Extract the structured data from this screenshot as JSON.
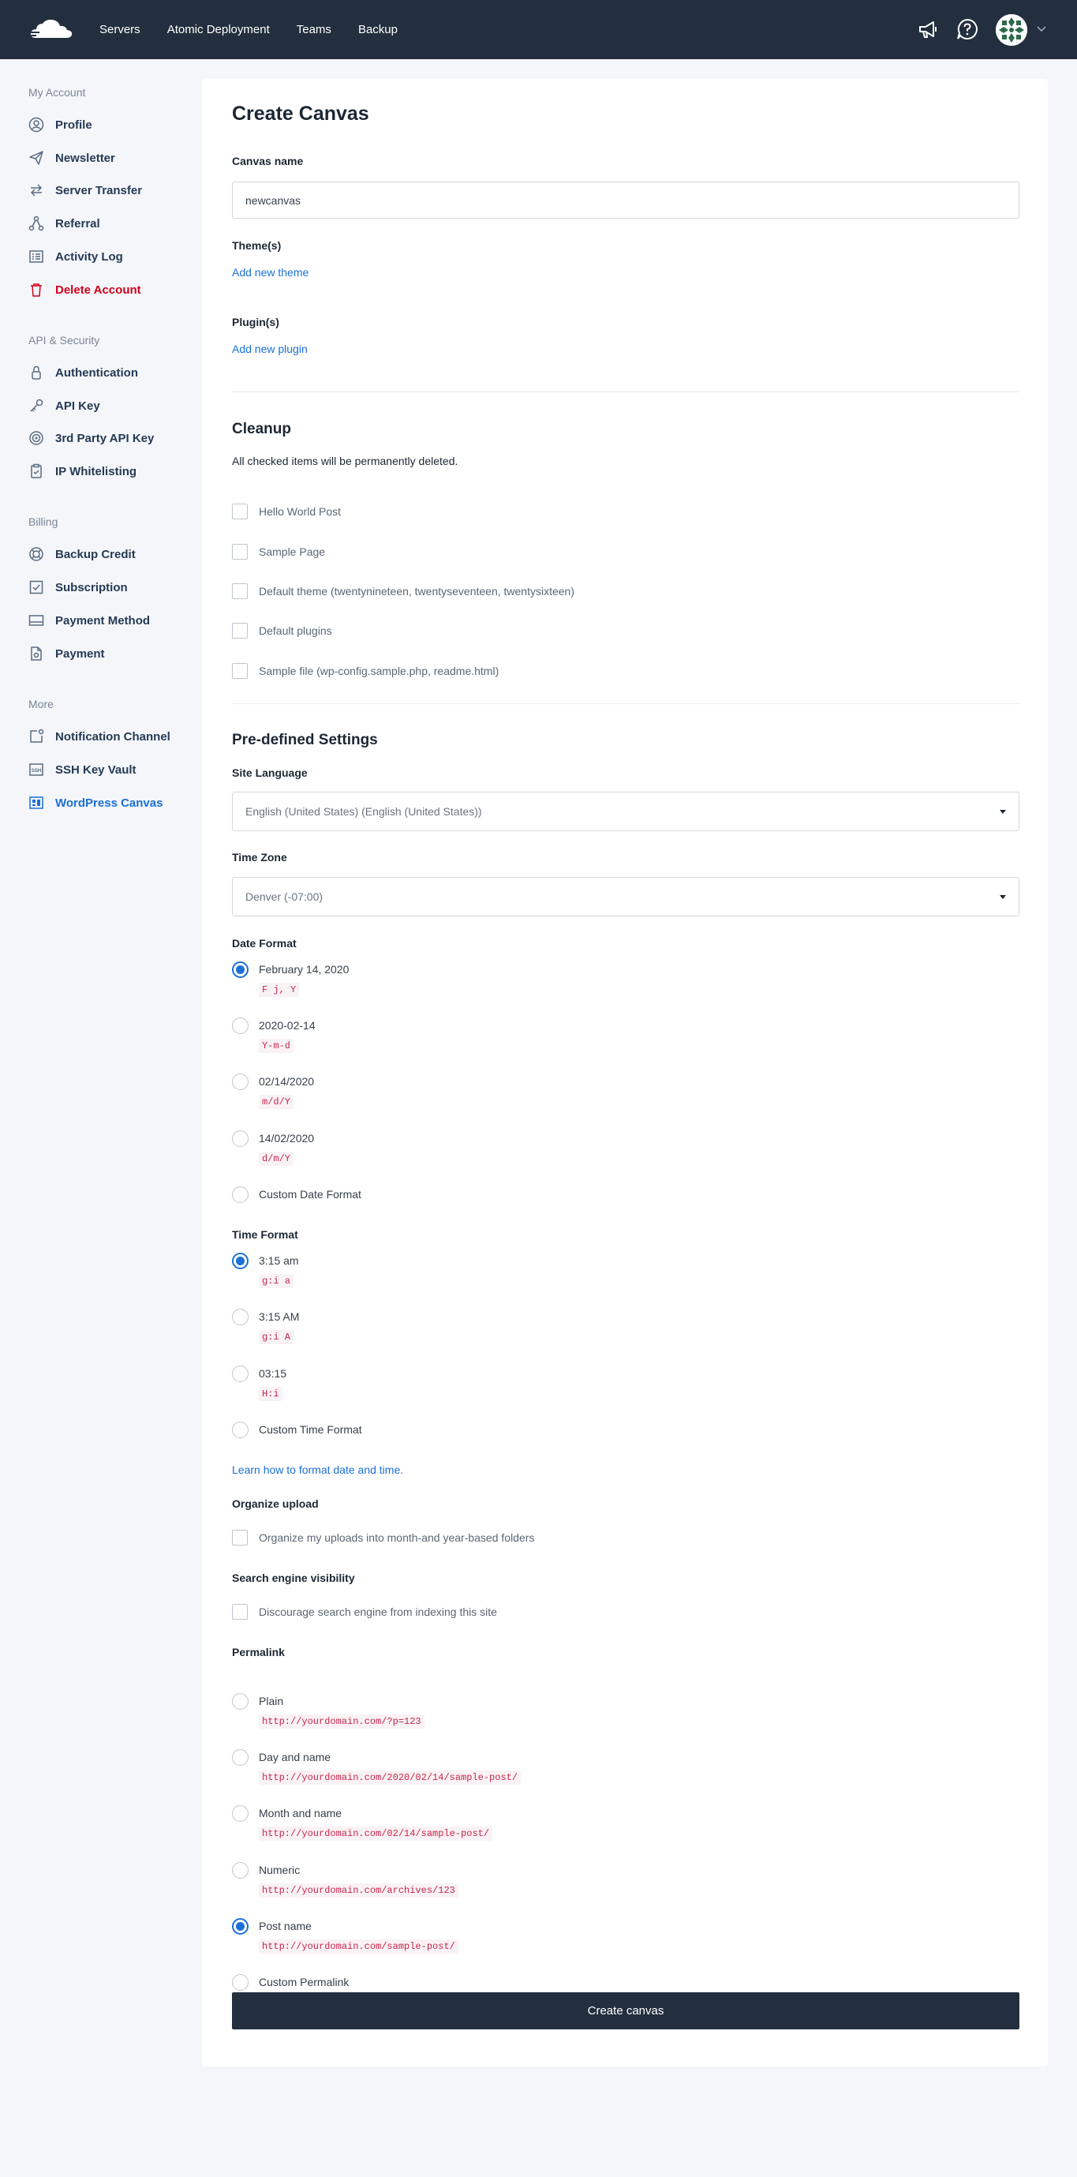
{
  "topnav": {
    "items": [
      "Servers",
      "Atomic Deployment",
      "Teams",
      "Backup"
    ]
  },
  "sidebar": {
    "sections": [
      {
        "title": "My Account",
        "items": [
          {
            "label": "Profile",
            "icon": "user-circle-icon"
          },
          {
            "label": "Newsletter",
            "icon": "paper-plane-icon"
          },
          {
            "label": "Server Transfer",
            "icon": "transfer-icon"
          },
          {
            "label": "Referral",
            "icon": "network-icon"
          },
          {
            "label": "Activity Log",
            "icon": "list-icon"
          },
          {
            "label": "Delete Account",
            "icon": "trash-icon"
          }
        ]
      },
      {
        "title": "API & Security",
        "items": [
          {
            "label": "Authentication",
            "icon": "lock-icon"
          },
          {
            "label": "API Key",
            "icon": "key-icon"
          },
          {
            "label": "3rd Party API Key",
            "icon": "target-icon"
          },
          {
            "label": "IP Whitelisting",
            "icon": "clipboard-icon"
          }
        ]
      },
      {
        "title": "Billing",
        "items": [
          {
            "label": "Backup Credit",
            "icon": "lifebuoy-icon"
          },
          {
            "label": "Subscription",
            "icon": "check-box-icon"
          },
          {
            "label": "Payment Method",
            "icon": "card-icon"
          },
          {
            "label": "Payment",
            "icon": "document-icon"
          }
        ]
      },
      {
        "title": "More",
        "items": [
          {
            "label": "Notification Channel",
            "icon": "notification-icon"
          },
          {
            "label": "SSH Key Vault",
            "icon": "ssh-icon"
          },
          {
            "label": "WordPress Canvas",
            "icon": "canvas-icon"
          }
        ]
      }
    ]
  },
  "form": {
    "title": "Create Canvas",
    "canvas_name_label": "Canvas name",
    "canvas_name_value": "newcanvas",
    "themes_label": "Theme(s)",
    "add_theme": "Add new theme",
    "plugins_label": "Plugin(s)",
    "add_plugin": "Add new plugin",
    "cleanup_title": "Cleanup",
    "cleanup_desc": "All checked items will be permanently deleted.",
    "cleanup_items": [
      "Hello World Post",
      "Sample Page",
      "Default theme (twentynineteen, twentyseventeen, twentysixteen)",
      "Default plugins",
      "Sample file (wp-config.sample.php, readme.html)"
    ],
    "predefined_title": "Pre-defined Settings",
    "site_language_label": "Site Language",
    "site_language_value": "English (United States) (English (United States))",
    "time_zone_label": "Time Zone",
    "time_zone_value": "Denver (-07:00)",
    "date_format_label": "Date Format",
    "date_formats": [
      {
        "label": "February 14, 2020",
        "code": "F j, Y"
      },
      {
        "label": "2020-02-14",
        "code": "Y-m-d"
      },
      {
        "label": "02/14/2020",
        "code": "m/d/Y"
      },
      {
        "label": "14/02/2020",
        "code": "d/m/Y"
      },
      {
        "label": "Custom Date Format",
        "code": ""
      }
    ],
    "date_format_selected": 0,
    "time_format_label": "Time Format",
    "time_formats": [
      {
        "label": "3:15 am",
        "code": "g:i a"
      },
      {
        "label": "3:15 AM",
        "code": "g:i A"
      },
      {
        "label": "03:15",
        "code": "H:i"
      },
      {
        "label": "Custom Time Format",
        "code": ""
      }
    ],
    "time_format_selected": 0,
    "learn_link": "Learn how to format date and time.",
    "organize_label": "Organize upload",
    "organize_checkbox": "Organize my uploads into month-and year-based folders",
    "search_label": "Search engine visibility",
    "search_checkbox": "Discourage search engine from indexing this site",
    "permalink_label": "Permalink",
    "permalinks": [
      {
        "label": "Plain",
        "code": "http://yourdomain.com/?p=123"
      },
      {
        "label": "Day and name",
        "code": "http://yourdomain.com/2020/02/14/sample-post/"
      },
      {
        "label": "Month and name",
        "code": "http://yourdomain.com/02/14/sample-post/"
      },
      {
        "label": "Numeric",
        "code": "http://yourdomain.com/archives/123"
      },
      {
        "label": "Post name",
        "code": "http://yourdomain.com/sample-post/"
      },
      {
        "label": "Custom Permalink",
        "code": ""
      }
    ],
    "permalink_selected": 4,
    "submit": "Create canvas"
  },
  "colors": {
    "topbar": "#232f3e",
    "accent": "#1b6fd6",
    "danger": "#d0021b",
    "code": "#c7254e"
  }
}
